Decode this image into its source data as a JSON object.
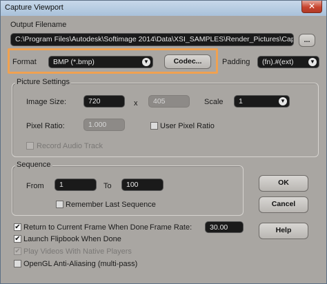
{
  "window": {
    "title": "Capture Viewport",
    "close_glyph": "✕"
  },
  "output": {
    "label": "Output Filename",
    "path": "C:\\Program Files\\Autodesk\\Softimage 2014\\Data\\XSI_SAMPLES\\Render_Pictures\\Capture.bmp",
    "browse_label": "..."
  },
  "format": {
    "label": "Format",
    "value": "BMP (*.bmp)",
    "codec_label": "Codec...",
    "padding_label": "Padding",
    "padding_value": "(fn).#(ext)"
  },
  "picture_settings": {
    "title": "Picture Settings",
    "image_size_label": "Image Size:",
    "width": "720",
    "x_label": "x",
    "height": "405",
    "scale_label": "Scale",
    "scale_value": "1",
    "pixel_ratio_label": "Pixel Ratio:",
    "pixel_ratio_value": "1.000",
    "user_pixel_ratio_label": "User Pixel Ratio",
    "record_audio_label": "Record Audio Track"
  },
  "sequence": {
    "title": "Sequence",
    "from_label": "From",
    "from_value": "1",
    "to_label": "To",
    "to_value": "100",
    "remember_label": "Remember Last Sequence"
  },
  "buttons": {
    "ok": "OK",
    "cancel": "Cancel",
    "help": "Help"
  },
  "options": {
    "return_frame_label": "Return to Current Frame When Done",
    "launch_flipbook_label": "Launch Flipbook When Done",
    "native_players_label": "Play Videos With Native Players",
    "antialiasing_label": "OpenGL Anti-Aliasing (multi-pass)",
    "frame_rate_label": "Frame Rate:",
    "frame_rate_value": "30.00",
    "check_glyph": "✔"
  },
  "colors": {
    "highlight": "#f0a150",
    "field_bg": "#1a1a1a",
    "dialog_bg": "#a9a6a2"
  },
  "icons": {
    "close": "close-icon",
    "dropdown": "chevron-down-icon",
    "check": "checkmark-icon"
  }
}
